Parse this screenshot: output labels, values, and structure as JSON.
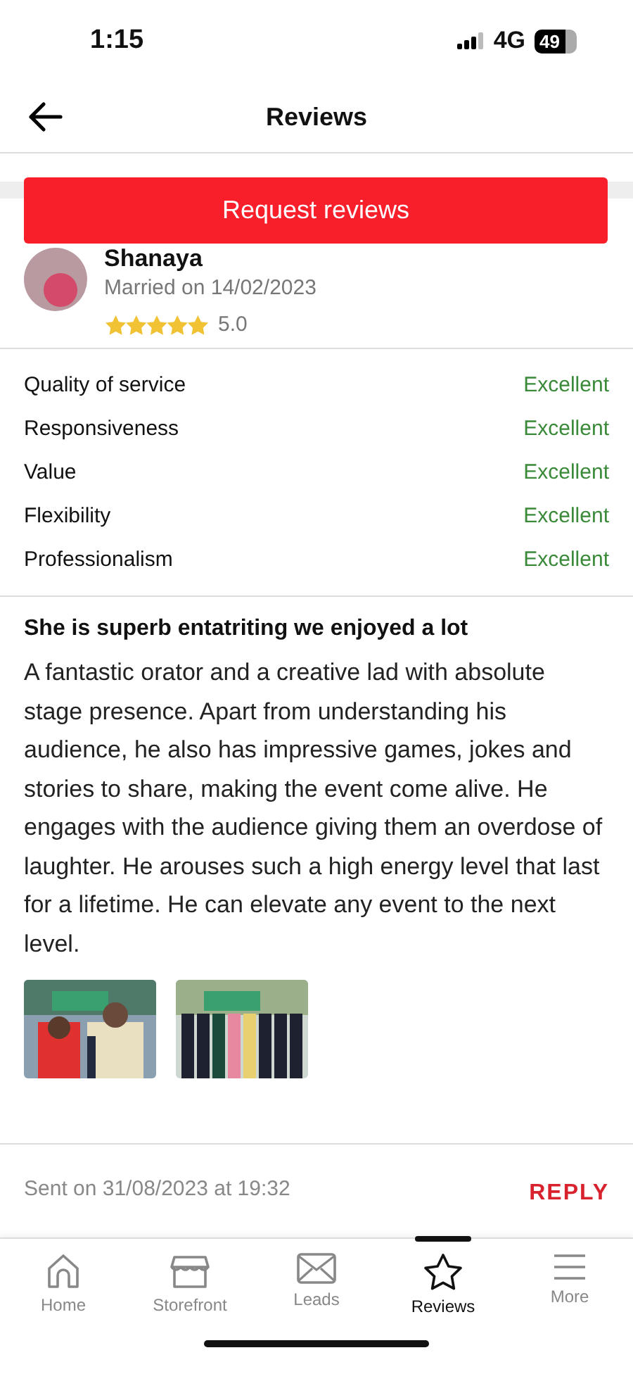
{
  "status_bar": {
    "time": "1:15",
    "network": "4G",
    "battery": "49"
  },
  "header": {
    "title": "Reviews"
  },
  "request_button": {
    "label": "Request reviews"
  },
  "review": {
    "name": "Shanaya",
    "married": "Married on 14/02/2023",
    "stars": 5,
    "score": "5.0",
    "ratings": [
      {
        "label": "Quality of service",
        "value": "Excellent"
      },
      {
        "label": "Responsiveness",
        "value": "Excellent"
      },
      {
        "label": "Value",
        "value": "Excellent"
      },
      {
        "label": "Flexibility",
        "value": "Excellent"
      },
      {
        "label": "Professionalism",
        "value": "Excellent"
      }
    ],
    "title": "She is superb entatriting we enjoyed a lot",
    "body": "A fantastic orator and a creative lad with absolute stage presence. Apart from understanding his audience, he also has impressive games, jokes and stories to share, making the event come alive. He engages with the audience giving them an overdose of laughter. He arouses such a high energy level that last for a lifetime. He can elevate any event to the next level.",
    "photos": [
      {
        "kind": "picture"
      },
      {
        "kind": "picture"
      }
    ],
    "sent": "Sent on 31/08/2023 at 19:32",
    "reply": "REPLY"
  },
  "tabs": [
    {
      "label": "Home",
      "selected": false
    },
    {
      "label": "Storefront",
      "selected": false
    },
    {
      "label": "Leads",
      "selected": false
    },
    {
      "label": "Reviews",
      "selected": true
    },
    {
      "label": "More",
      "selected": false
    }
  ]
}
